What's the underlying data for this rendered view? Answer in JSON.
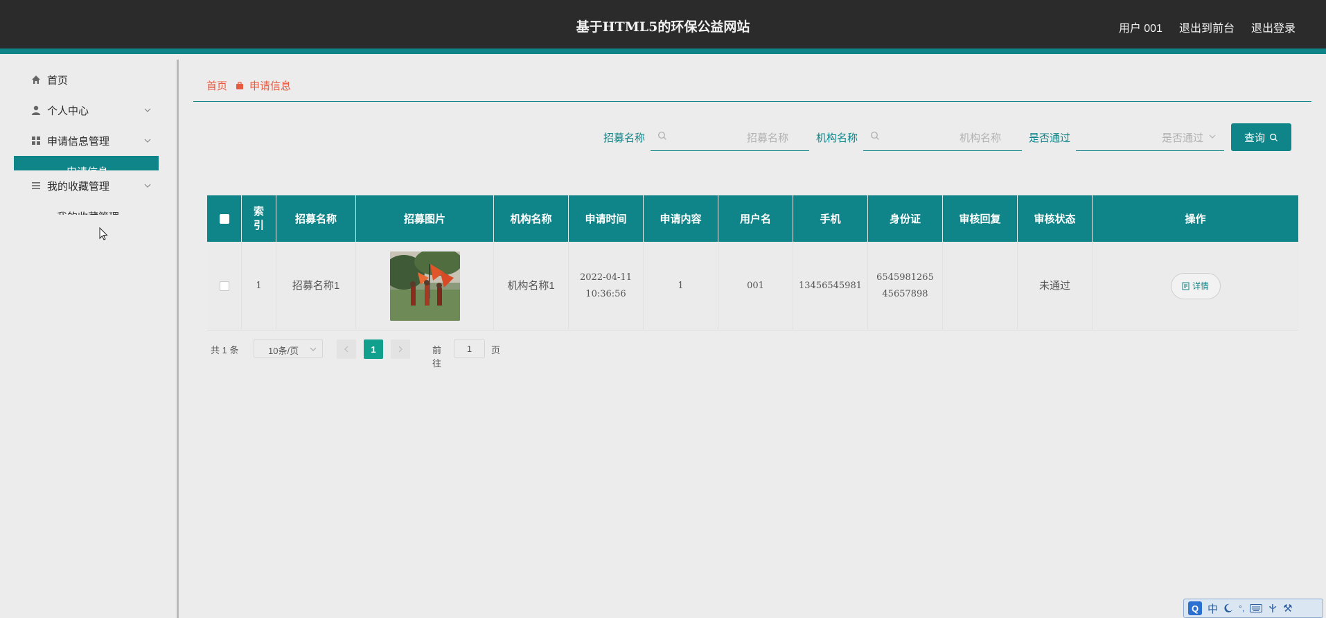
{
  "header": {
    "title": "基于HTML5的环保公益网站",
    "user_label": "用户 001",
    "frontend_link": "退出到前台",
    "logout_link": "退出登录"
  },
  "sidebar": {
    "items": [
      {
        "label": "首页",
        "icon": "home-icon"
      },
      {
        "label": "个人中心",
        "icon": "user-icon"
      },
      {
        "label": "申请信息管理",
        "icon": "grid-icon"
      },
      {
        "label": "我的收藏管理",
        "icon": "list-icon"
      }
    ],
    "active_sub": "申请信息",
    "fav_sub": "我的收藏管理"
  },
  "breadcrumb": {
    "home": "首页",
    "current": "申请信息"
  },
  "search": {
    "recruit_label": "招募名称",
    "recruit_placeholder": "招募名称",
    "org_label": "机构名称",
    "org_placeholder": "机构名称",
    "pass_label": "是否通过",
    "pass_placeholder": "是否通过",
    "query_button": "查询"
  },
  "table": {
    "headers": [
      "",
      "索引",
      "招募名称",
      "招募图片",
      "机构名称",
      "申请时间",
      "申请内容",
      "用户名",
      "手机",
      "身份证",
      "审核回复",
      "审核状态",
      "操作"
    ],
    "rows": [
      {
        "index": "1",
        "recruit_name": "招募名称1",
        "org_name": "机构名称1",
        "apply_time": "2022-04-11 10:36:56",
        "apply_content": "1",
        "username": "001",
        "phone": "13456545981",
        "id_card": "654598126545657898",
        "review_reply": "",
        "review_status": "未通过",
        "action_label": "详情"
      }
    ]
  },
  "pagination": {
    "total_text": "共 1 条",
    "page_size": "10条/页",
    "current_page": "1",
    "goto_label": "前往",
    "goto_value": "1",
    "page_unit": "页"
  },
  "ime": {
    "mode": "中",
    "punct": "°,",
    "tool": "⚒"
  },
  "colors": {
    "header_bg": "#2b2b2b",
    "accent_teal": "#0f8589",
    "page_active": "#11a08e",
    "breadcrumb": "#e85a3f"
  }
}
